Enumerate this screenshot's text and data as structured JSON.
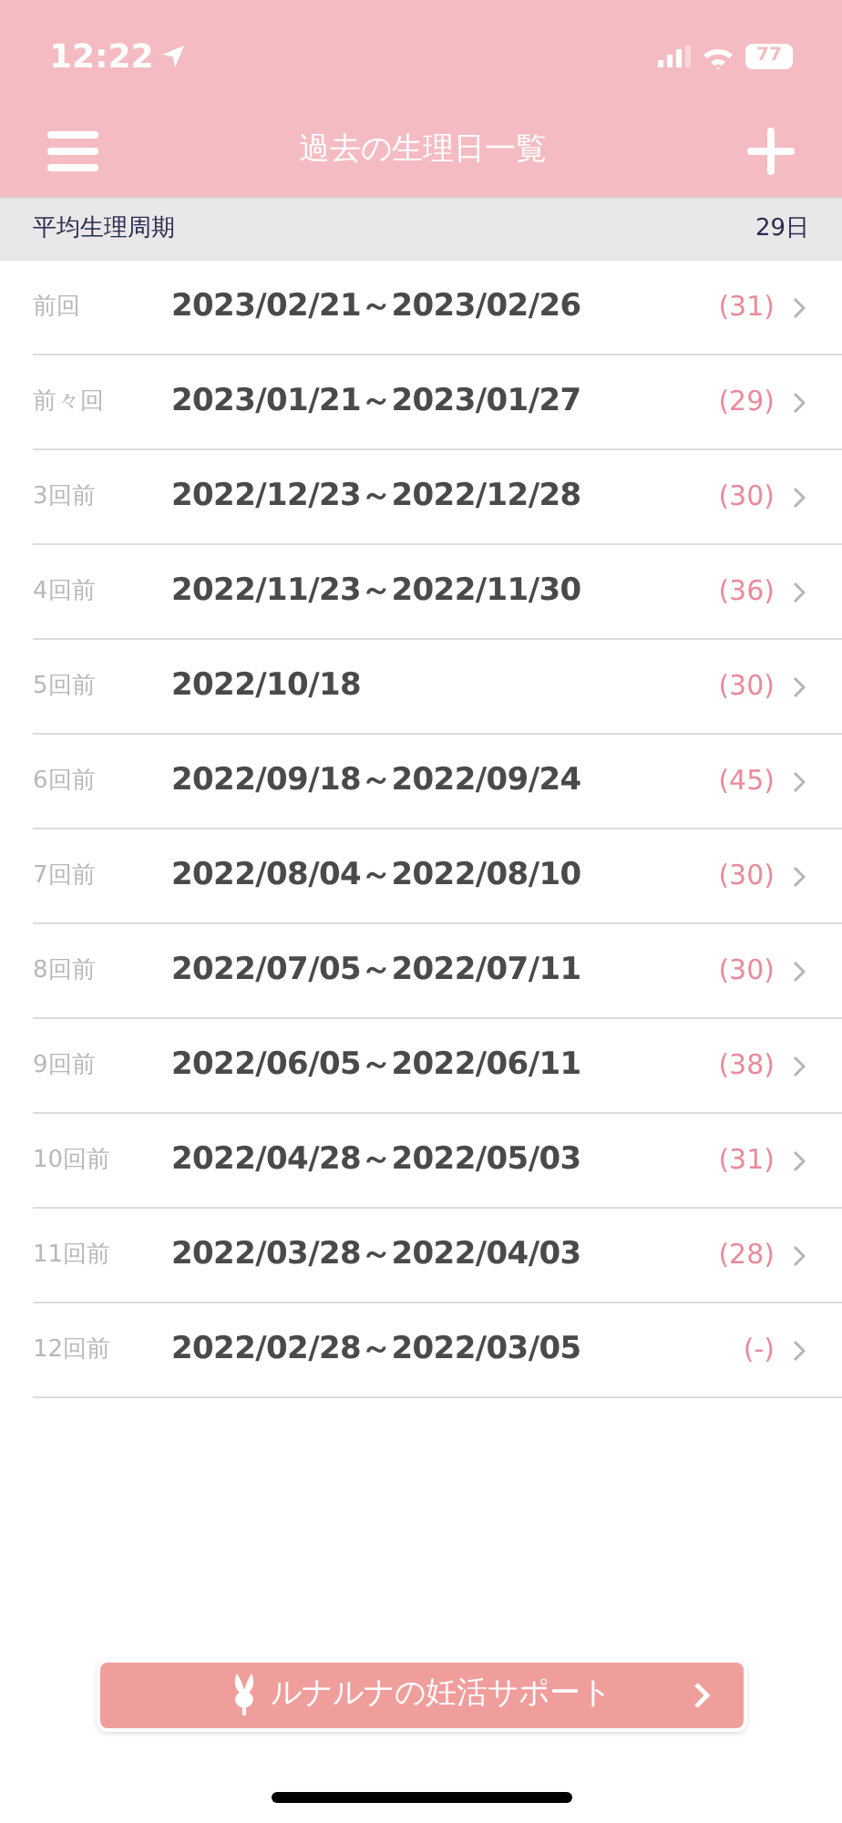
{
  "status_bar": {
    "time": "12:22",
    "battery": "77"
  },
  "nav": {
    "title": "過去の生理日一覧"
  },
  "average": {
    "label": "平均生理周期",
    "value": "29日"
  },
  "periods": [
    {
      "label": "前回",
      "dates": "2023/02/21～2023/02/26",
      "cycle": "(31)"
    },
    {
      "label": "前々回",
      "dates": "2023/01/21～2023/01/27",
      "cycle": "(29)"
    },
    {
      "label": "3回前",
      "dates": "2022/12/23～2022/12/28",
      "cycle": "(30)"
    },
    {
      "label": "4回前",
      "dates": "2022/11/23～2022/11/30",
      "cycle": "(36)"
    },
    {
      "label": "5回前",
      "dates": "2022/10/18",
      "cycle": "(30)"
    },
    {
      "label": "6回前",
      "dates": "2022/09/18～2022/09/24",
      "cycle": "(45)"
    },
    {
      "label": "7回前",
      "dates": "2022/08/04～2022/08/10",
      "cycle": "(30)"
    },
    {
      "label": "8回前",
      "dates": "2022/07/05～2022/07/11",
      "cycle": "(30)"
    },
    {
      "label": "9回前",
      "dates": "2022/06/05～2022/06/11",
      "cycle": "(38)"
    },
    {
      "label": "10回前",
      "dates": "2022/04/28～2022/05/03",
      "cycle": "(31)"
    },
    {
      "label": "11回前",
      "dates": "2022/03/28～2022/04/03",
      "cycle": "(28)"
    },
    {
      "label": "12回前",
      "dates": "2022/02/28～2022/03/05",
      "cycle": "(-)"
    }
  ],
  "support_button": {
    "label": "ルナルナの妊活サポート"
  }
}
